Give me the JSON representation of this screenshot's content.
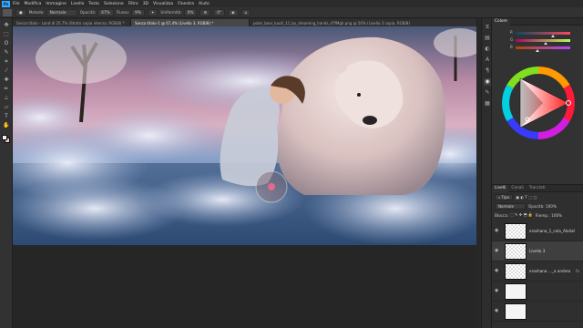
{
  "app": {
    "logo": "Ps",
    "menu": [
      "File",
      "Modifica",
      "Immagine",
      "Livello",
      "Testo",
      "Selezione",
      "Filtro",
      "3D",
      "Visualizza",
      "Finestra",
      "Aiuto"
    ]
  },
  "options": {
    "mode_label": "Metodo:",
    "mode_value": "Normale",
    "opacity_label": "Opacità:",
    "opacity_value": "67%",
    "flow_label": "Flusso:",
    "flow_value": "9%",
    "smoothing_label": "Uniformità:",
    "smoothing_value": "0%",
    "angle_value": "0°"
  },
  "tabs": [
    {
      "label": "Senza titolo - Land di 35.7% (Strato copia interna, RGB/8) *",
      "active": false
    },
    {
      "label": "Senza titolo-1 @ 67,4% (Livello 3, RGB/8) *",
      "active": true
    },
    {
      "label": "polar_bear_kauti_11_by_dreaming_hands_d7fMgh.png @ 50% (Livello 3 copia, RGB/8)",
      "active": false
    }
  ],
  "color_panel": {
    "tabs": [
      "Colore"
    ],
    "sliders": [
      {
        "label": "R",
        "value": 0.69
      },
      {
        "label": "G",
        "value": 0.55
      },
      {
        "label": "B",
        "value": 0.4
      }
    ]
  },
  "layers_panel": {
    "tabs": [
      "Livelli",
      "Canali",
      "Tracciati"
    ],
    "filter_label": "Tipo",
    "blend_mode": "Normale",
    "opacity_label": "Opacità:",
    "opacity_value": "100%",
    "lock_label": "Blocca:",
    "fill_label": "Riemp.:",
    "fill_value": "100%",
    "layers": [
      {
        "name": "erashana_1_colo_Alaliah",
        "selected": false,
        "fx": ""
      },
      {
        "name": "Livello 3",
        "selected": true,
        "fx": ""
      },
      {
        "name": "erashana ..._a andrea",
        "selected": false,
        "fx": "fx"
      },
      {
        "name": "",
        "selected": false,
        "fx": ""
      },
      {
        "name": "",
        "selected": false,
        "fx": ""
      }
    ]
  },
  "colors": {
    "accent": "#31a8ff",
    "foreground": "#f0f0f0",
    "background": "#e9c4c9"
  }
}
